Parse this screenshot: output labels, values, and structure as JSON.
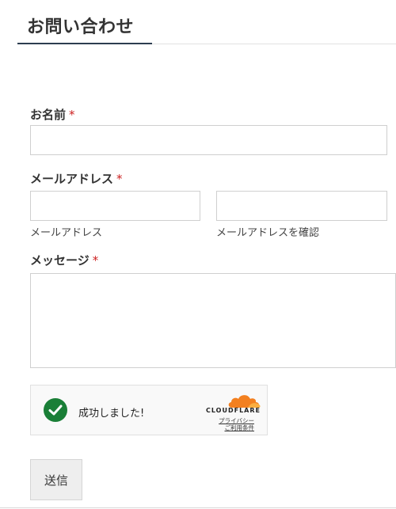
{
  "page": {
    "title": "お問い合わせ"
  },
  "form": {
    "name": {
      "label": "お名前",
      "required_mark": "*",
      "value": ""
    },
    "email": {
      "label": "メールアドレス",
      "required_mark": "*",
      "value": "",
      "confirm_value": "",
      "sublabel": "メールアドレス",
      "confirm_sublabel": "メールアドレスを確認"
    },
    "message": {
      "label": "メッセージ",
      "required_mark": "*",
      "value": ""
    },
    "submit_label": "送信"
  },
  "captcha": {
    "status_text": "成功しました!",
    "status_icon": "checkmark-icon",
    "brand": "CLOUDFLARE",
    "privacy_link": "プライバシー",
    "terms_link": "ご利用条件",
    "colors": {
      "success": "#1a7f37",
      "cloud": "#f38020"
    }
  },
  "colors": {
    "required": "#cc1f1f",
    "title_underline": "#2c3e50"
  }
}
